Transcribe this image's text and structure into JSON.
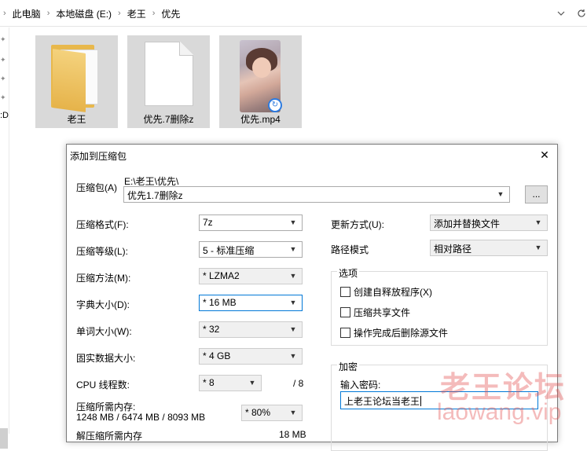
{
  "explorer": {
    "breadcrumbs": [
      "此电脑",
      "本地磁盘 (E:)",
      "老王",
      "优先"
    ],
    "breadcrumb_arrow": "›",
    "refresh_icon": "refresh-icon",
    "dropdown_icon": "chevron-down-icon",
    "left_pane_partial_letter": ":D",
    "files": [
      {
        "name": "老王",
        "type": "folder"
      },
      {
        "name": "优先.7删除z",
        "type": "file"
      },
      {
        "name": "优先.mp4",
        "type": "video"
      }
    ]
  },
  "dialog": {
    "title": "添加到压缩包",
    "close_glyph": "✕",
    "archive_label": "压缩包(A)",
    "archive_path": "E:\\老王\\优先\\",
    "archive_name": "优先1.7删除z",
    "browse_label": "...",
    "left": {
      "format_label": "压缩格式(F):",
      "format_value": "7z",
      "level_label": "压缩等级(L):",
      "level_value": "5 - 标准压缩",
      "method_label": "压缩方法(M):",
      "method_value": "* LZMA2",
      "dict_label": "字典大小(D):",
      "dict_value": "* 16 MB",
      "word_label": "单词大小(W):",
      "word_value": "* 32",
      "solid_label": "固实数据大小:",
      "solid_value": "* 4 GB",
      "cpu_label": "CPU 线程数:",
      "cpu_value": "* 8",
      "cpu_total": "/ 8",
      "mem_label": "压缩所需内存:",
      "mem_values": "1248 MB / 6474 MB / 8093 MB",
      "mem_percent": "* 80%",
      "decomp_label": "解压缩所需内存",
      "decomp_value": "18 MB"
    },
    "right": {
      "update_label": "更新方式(U):",
      "update_value": "添加并替换文件",
      "path_label": "路径模式",
      "path_value": "相对路径",
      "options_title": "选项",
      "options": [
        "创建自释放程序(X)",
        "压缩共享文件",
        "操作完成后删除源文件"
      ],
      "encrypt_title": "加密",
      "password_label": "输入密码:",
      "password_value": "上老王论坛当老王"
    }
  },
  "watermark": {
    "text_cn": "老王论坛",
    "text_en": "laowang.vip"
  },
  "colors": {
    "tile_bg": "#d9d9d9",
    "focus_border": "#0078d7",
    "watermark": "#e24d4d"
  }
}
